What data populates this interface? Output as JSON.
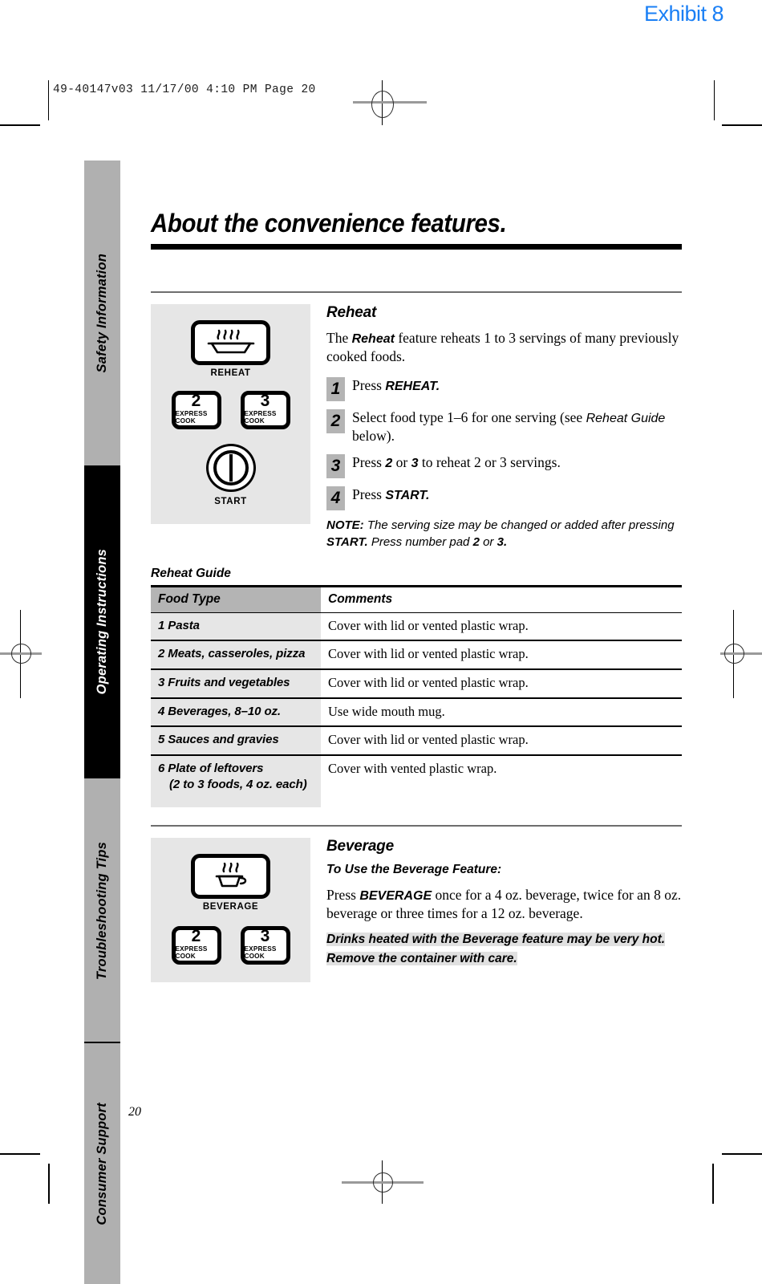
{
  "print_marks": {
    "exhibit_label": "Exhibit 8",
    "slugline": "49-40147v03  11/17/00  4:10 PM  Page 20"
  },
  "tabs": [
    {
      "label": "Safety Information",
      "style": "gray"
    },
    {
      "label": "Operating Instructions",
      "style": "black"
    },
    {
      "label": "Troubleshooting Tips",
      "style": "gray"
    },
    {
      "label": "Consumer Support",
      "style": "gray"
    }
  ],
  "page": {
    "title": "About the convenience features.",
    "number": "20"
  },
  "reheat": {
    "heading": "Reheat",
    "intro_a": "The ",
    "intro_b": "Reheat",
    "intro_c": " feature reheats 1 to 3 servings of many previously cooked foods.",
    "steps": [
      {
        "num": "1",
        "a": "Press ",
        "b": "REHEAT.",
        "c": ""
      },
      {
        "num": "2",
        "a": "Select food type 1–6 for one serving (see ",
        "b": "",
        "c": ""
      },
      {
        "num": "3",
        "a": "Press ",
        "b": "2",
        "c": " or "
      },
      {
        "num": "4",
        "a": "Press ",
        "b": "START.",
        "c": ""
      }
    ],
    "step2_italic": "Reheat Guide",
    "step2_tail": " below).",
    "step3_b2": "3",
    "step3_tail": " to reheat 2 or 3 servings.",
    "note_label": "NOTE:",
    "note_a": " The serving size may be changed or added after pressing ",
    "note_b": "START.",
    "note_c": " Press number pad ",
    "note_d": "2",
    "note_e": " or ",
    "note_f": "3.",
    "panel": {
      "main_button_label": "REHEAT",
      "main_button_icon": "steaming-dish-icon",
      "num_buttons": [
        {
          "digit": "2",
          "sub": "EXPRESS COOK"
        },
        {
          "digit": "3",
          "sub": "EXPRESS COOK"
        }
      ],
      "start_label": "START",
      "start_icon": "power-bar-icon"
    }
  },
  "reheat_guide": {
    "caption": "Reheat Guide",
    "columns": [
      "Food Type",
      "Comments"
    ],
    "rows": [
      {
        "food": "1  Pasta",
        "food2": "",
        "comment": "Cover with lid or vented plastic wrap."
      },
      {
        "food": "2  Meats, casseroles, pizza",
        "food2": "",
        "comment": "Cover with lid or vented plastic wrap."
      },
      {
        "food": "3  Fruits and vegetables",
        "food2": "",
        "comment": "Cover with lid or vented plastic wrap."
      },
      {
        "food": "4  Beverages, 8–10 oz.",
        "food2": "",
        "comment": "Use wide mouth mug."
      },
      {
        "food": "5  Sauces and gravies",
        "food2": "",
        "comment": "Cover with lid or vented plastic wrap."
      },
      {
        "food": "6  Plate of leftovers",
        "food2": "(2 to 3 foods, 4 oz. each)",
        "comment": "Cover with vented plastic wrap."
      }
    ]
  },
  "beverage": {
    "heading": "Beverage",
    "sub_head": "To Use the Beverage Feature:",
    "body_a": "Press ",
    "body_b": "BEVERAGE",
    "body_c": " once for a 4 oz. beverage, twice for an 8 oz. beverage or three times for a 12 oz. beverage.",
    "caution": "Drinks heated with the Beverage feature may be very hot. Remove the container with care.",
    "panel": {
      "main_button_label": "BEVERAGE",
      "main_button_icon": "steaming-cup-icon",
      "num_buttons": [
        {
          "digit": "2",
          "sub": "EXPRESS COOK"
        },
        {
          "digit": "3",
          "sub": "EXPRESS COOK"
        }
      ]
    }
  },
  "colors": {
    "exhibit_blue": "#1a7ff5",
    "tab_gray": "#b0b0b0",
    "tab_active_black": "#000000",
    "panel_gray": "#e6e6e6",
    "table_header_gray": "#b4b4b4",
    "table_cell_gray": "#e6e6e6",
    "rule_gray": "#6e6e6e"
  }
}
